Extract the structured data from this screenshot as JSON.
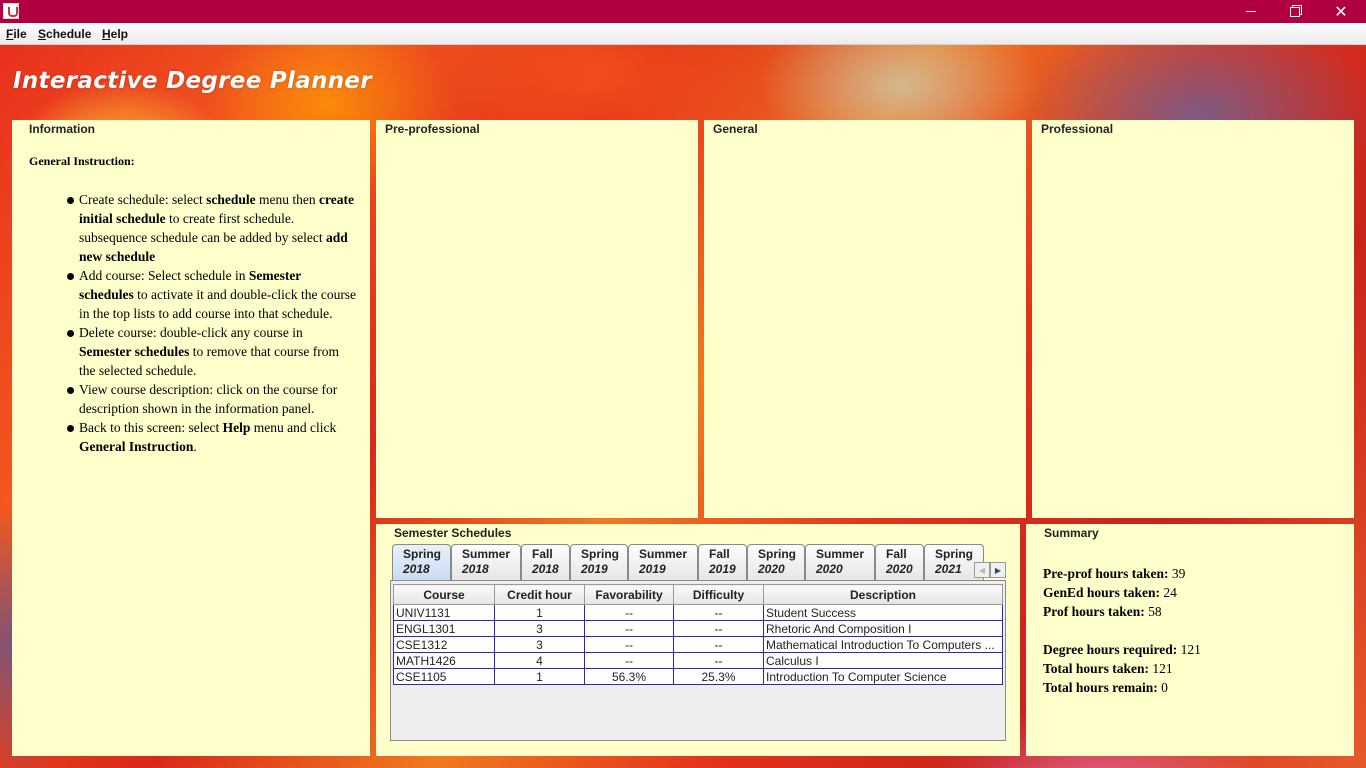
{
  "window": {
    "icon": "java-cup-icon",
    "minimize": "minimize-icon",
    "maximize": "restore-icon",
    "close": "close-icon",
    "titlebar_color": "#b00040"
  },
  "menu": {
    "file_key": "F",
    "file_rest": "ile",
    "schedule_key": "S",
    "schedule_rest": "chedule",
    "help_key": "H",
    "help_rest": "elp"
  },
  "app_title": "Interactive Degree Planner",
  "info": {
    "title": "Information",
    "heading": "General Instruction:",
    "items": [
      {
        "a": "Create schedule: select ",
        "b": "schedule",
        "c": " menu then ",
        "d": "create initial schedule",
        "e": " to create first schedule. subsequence schedule can be added by select ",
        "f": "add new schedule",
        "g": ""
      },
      {
        "a": "Add course: Select schedule in ",
        "b": "Semester schedules",
        "c": " to activate it and double-click the course in the top lists to add course into that schedule.",
        "d": "",
        "e": "",
        "f": "",
        "g": ""
      },
      {
        "a": "Delete course: double-click any course in ",
        "b": "Semester schedules",
        "c": " to remove that course from the selected schedule.",
        "d": "",
        "e": "",
        "f": "",
        "g": ""
      },
      {
        "a": "View course description: click on the course for description shown in the information panel.",
        "b": "",
        "c": "",
        "d": "",
        "e": "",
        "f": "",
        "g": ""
      },
      {
        "a": "Back to this screen: select ",
        "b": "Help",
        "c": " menu and click ",
        "d": "General Instruction",
        "e": ".",
        "f": "",
        "g": ""
      }
    ]
  },
  "panels": {
    "pre": "Pre-professional",
    "general": "General",
    "professional": "Professional",
    "panel_color": "#ffffcc"
  },
  "semester": {
    "title": "Semester Schedules",
    "tabs": [
      {
        "term": "Spring",
        "year": "2018"
      },
      {
        "term": "Summer",
        "year": "2018"
      },
      {
        "term": "Fall",
        "year": "2018"
      },
      {
        "term": "Spring",
        "year": "2019"
      },
      {
        "term": "Summer",
        "year": "2019"
      },
      {
        "term": "Fall",
        "year": "2019"
      },
      {
        "term": "Spring",
        "year": "2020"
      },
      {
        "term": "Summer",
        "year": "2020"
      },
      {
        "term": "Fall",
        "year": "2020"
      },
      {
        "term": "Spring",
        "year": "2021"
      }
    ],
    "columns": [
      "Course",
      "Credit hour",
      "Favorability",
      "Difficulty",
      "Description"
    ],
    "rows": [
      [
        "UNIV1131",
        "1",
        "--",
        "--",
        "Student Success"
      ],
      [
        "ENGL1301",
        "3",
        "--",
        "--",
        "Rhetoric And Composition I"
      ],
      [
        "CSE1312",
        "3",
        "--",
        "--",
        "Mathematical Introduction To Computers ..."
      ],
      [
        "MATH1426",
        "4",
        "--",
        "--",
        "Calculus I"
      ],
      [
        "CSE1105",
        "1",
        "56.3%",
        "25.3%",
        "Introduction To Computer Science"
      ]
    ]
  },
  "summary": {
    "title": "Summary",
    "lines": [
      {
        "label": "Pre-prof hours taken:",
        "value": "39"
      },
      {
        "label": "GenEd hours taken:",
        "value": "24"
      },
      {
        "label": "Prof hours taken:",
        "value": "58"
      },
      {
        "label": "Degree hours required:",
        "value": "121"
      },
      {
        "label": "Total hours taken:",
        "value": "121"
      },
      {
        "label": "Total hours remain:",
        "value": "0"
      }
    ]
  }
}
